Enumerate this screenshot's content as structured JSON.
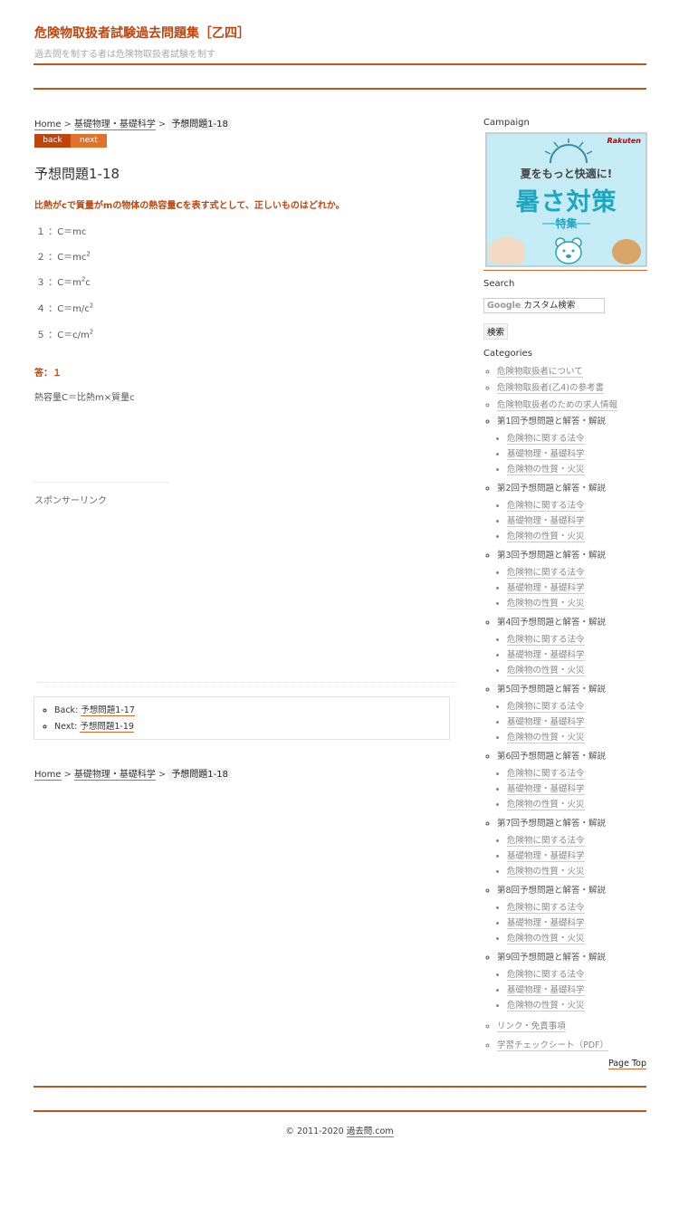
{
  "site": {
    "title": "危険物取扱者試験過去問題集［乙四］",
    "description": "過去問を制する者は危険物取扱者試験を制す"
  },
  "breadcrumb": {
    "home": "Home",
    "separator": ">",
    "category": "基礎物理・基礎科学",
    "current": "予想問題1-18"
  },
  "nav": {
    "back": "back",
    "next": "next"
  },
  "article": {
    "title": "予想問題1-18",
    "question": "比熱がcで質量がmの物体の熱容量Cを表す式として、正しいものはどれか。",
    "choices": [
      {
        "num": "１",
        "colon": "：",
        "text": "C＝mc",
        "sup": ""
      },
      {
        "num": "２",
        "colon": "：",
        "text": "C＝mc",
        "sup": "2"
      },
      {
        "num": "３",
        "colon": "：",
        "text": "C＝m",
        "sup": "2",
        "after": "c"
      },
      {
        "num": "４",
        "colon": "：",
        "text": "C＝m/c",
        "sup": "2"
      },
      {
        "num": "５",
        "colon": "：",
        "text": "C＝c/m",
        "sup": "2"
      }
    ],
    "answer": "答：１",
    "explanation": "熱容量C＝比熱m×質量c",
    "sponsor": "スポンサーリンク"
  },
  "backnext": {
    "back_label": "Back:",
    "back_link": "予想問題1-17",
    "next_label": "Next:",
    "next_link": "予想問題1-19"
  },
  "sidebar": {
    "campaign_heading": "Campaign",
    "campaign": {
      "logo": "Rakuten",
      "subtitle": "夏をもっと快適に!",
      "main": "暑さ対策",
      "tokushu": "──特集──"
    },
    "search_heading": "Search",
    "search_google": "Google",
    "search_placeholder": "カスタム検索",
    "search_button": "検索",
    "categories_heading": "Categories",
    "top_links": [
      "危険物取扱者について",
      "危険物取扱者(乙4)の参考書",
      "危険物取扱者のための求人情報"
    ],
    "rounds": [
      {
        "title": "第1回予想問題と解答・解説",
        "items": [
          "危険物に関する法令",
          "基礎物理・基礎科学",
          "危険物の性質・火災"
        ]
      },
      {
        "title": "第2回予想問題と解答・解説",
        "items": [
          "危険物に関する法令",
          "基礎物理・基礎科学",
          "危険物の性質・火災"
        ]
      },
      {
        "title": "第3回予想問題と解答・解説",
        "items": [
          "危険物に関する法令",
          "基礎物理・基礎科学",
          "危険物の性質・火災"
        ]
      },
      {
        "title": "第4回予想問題と解答・解説",
        "items": [
          "危険物に関する法令",
          "基礎物理・基礎科学",
          "危険物の性質・火災"
        ]
      },
      {
        "title": "第5回予想問題と解答・解説",
        "items": [
          "危険物に関する法令",
          "基礎物理・基礎科学",
          "危険物の性質・火災"
        ]
      },
      {
        "title": "第6回予想問題と解答・解説",
        "items": [
          "危険物に関する法令",
          "基礎物理・基礎科学",
          "危険物の性質・火災"
        ]
      },
      {
        "title": "第7回予想問題と解答・解説",
        "items": [
          "危険物に関する法令",
          "基礎物理・基礎科学",
          "危険物の性質・火災"
        ]
      },
      {
        "title": "第8回予想問題と解答・解説",
        "items": [
          "危険物に関する法令",
          "基礎物理・基礎科学",
          "危険物の性質・火災"
        ]
      },
      {
        "title": "第9回予想問題と解答・解説",
        "items": [
          "危険物に関する法令",
          "基礎物理・基礎科学",
          "危険物の性質・火災"
        ]
      }
    ],
    "bottom_links": [
      "リンク・免責事項",
      "学習チェックシート（PDF）"
    ]
  },
  "footer": {
    "page_top": "Page Top",
    "copyright_prefix": "© 2011-2020",
    "copyright_link": "過去問.com"
  },
  "colors": {
    "accent": "#c0450d",
    "next_button": "#e2722a",
    "rule": "#c0541e"
  }
}
